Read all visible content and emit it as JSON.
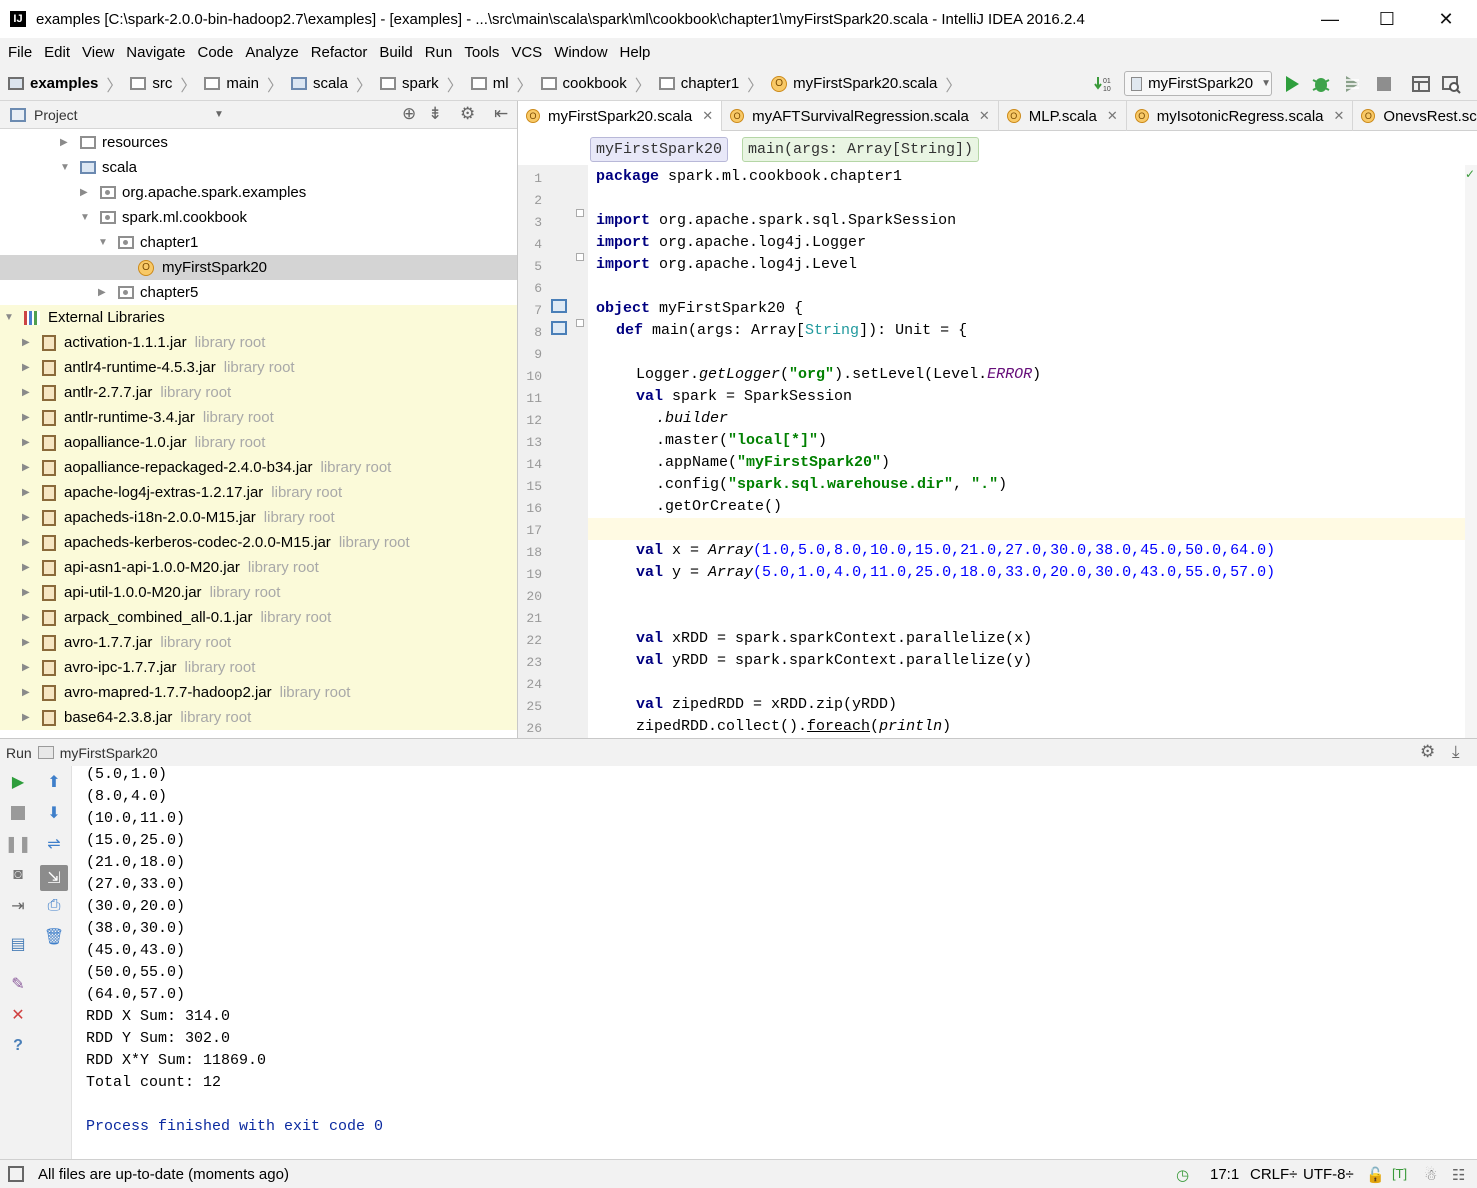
{
  "window": {
    "title": "examples [C:\\spark-2.0.0-bin-hadoop2.7\\examples] - [examples] - ...\\src\\main\\scala\\spark\\ml\\cookbook\\chapter1\\myFirstSpark20.scala - IntelliJ IDEA 2016.2.4",
    "app_icon": "IJ",
    "minimize": "—",
    "maximize": "☐",
    "close": "✕"
  },
  "menu": [
    "File",
    "Edit",
    "View",
    "Navigate",
    "Code",
    "Analyze",
    "Refactor",
    "Build",
    "Run",
    "Tools",
    "VCS",
    "Window",
    "Help"
  ],
  "breadcrumb": [
    "examples",
    "src",
    "main",
    "scala",
    "spark",
    "ml",
    "cookbook",
    "chapter1",
    "myFirstSpark20.scala"
  ],
  "toolbar": {
    "run_config": "myFirstSpark20",
    "icons": [
      "build-icon",
      "run-icon",
      "debug-icon",
      "coverage-icon",
      "stop-icon",
      "project-structure-icon",
      "search-everywhere-icon"
    ]
  },
  "project": {
    "title": "Project",
    "tree": [
      {
        "label": "resources",
        "kind": "folder",
        "indent": 1
      },
      {
        "label": "scala",
        "kind": "folder-open",
        "indent": 1
      },
      {
        "label": "org.apache.spark.examples",
        "kind": "package",
        "indent": 2
      },
      {
        "label": "spark.ml.cookbook",
        "kind": "package-open",
        "indent": 2
      },
      {
        "label": "chapter1",
        "kind": "package-open",
        "indent": 3
      },
      {
        "label": "myFirstSpark20",
        "kind": "object",
        "indent": 4
      },
      {
        "label": "chapter5",
        "kind": "package",
        "indent": 3
      },
      {
        "label": "External Libraries",
        "kind": "extlib",
        "indent": 0
      }
    ],
    "libraries": [
      "activation-1.1.1.jar",
      "antlr4-runtime-4.5.3.jar",
      "antlr-2.7.7.jar",
      "antlr-runtime-3.4.jar",
      "aopalliance-1.0.jar",
      "aopalliance-repackaged-2.4.0-b34.jar",
      "apache-log4j-extras-1.2.17.jar",
      "apacheds-i18n-2.0.0-M15.jar",
      "apacheds-kerberos-codec-2.0.0-M15.jar",
      "api-asn1-api-1.0.0-M20.jar",
      "api-util-1.0.0-M20.jar",
      "arpack_combined_all-0.1.jar",
      "avro-1.7.7.jar",
      "avro-ipc-1.7.7.jar",
      "avro-mapred-1.7.7-hadoop2.jar",
      "base64-2.3.8.jar"
    ],
    "library_suffix": "library root"
  },
  "tabs": [
    "myFirstSpark20.scala",
    "myAFTSurvivalRegression.scala",
    "MLP.scala",
    "myIsotonicRegress.scala",
    "OnevsRest.scala"
  ],
  "code_crumbs": [
    "myFirstSpark20",
    "main(args: Array[String])"
  ],
  "line_numbers": [
    "1",
    "2",
    "3",
    "4",
    "5",
    "6",
    "7",
    "8",
    "9",
    "10",
    "11",
    "12",
    "13",
    "14",
    "15",
    "16",
    "17",
    "18",
    "19",
    "20",
    "21",
    "22",
    "23",
    "24",
    "25",
    "26"
  ],
  "code": {
    "l1": "package spark.ml.cookbook.chapter1",
    "l3": "org.apache.spark.sql.SparkSession",
    "l4": "org.apache.log4j.Logger",
    "l5": "org.apache.log4j.Level",
    "import_kw": "import",
    "package_kw": "package",
    "l7_obj": "object",
    "l7_rest": " myFirstSpark20 {",
    "l8_def": "def",
    "l8_a": " main(args: Array[",
    "l8_type": "String",
    "l8_b": "]): Unit = {",
    "l10_a": "Logger.",
    "l10_m": "getLogger",
    "l10_b": "(",
    "l10_s": "\"org\"",
    "l10_c": ").setLevel(Level.",
    "l10_e": "ERROR",
    "l10_d": ")",
    "val_kw": "val",
    "l11": " spark = SparkSession",
    "l12": ".builder",
    "l13_a": ".master(",
    "l13_s": "\"local[*]\"",
    "l13_b": ")",
    "l14_a": ".appName(",
    "l14_s": "\"myFirstSpark20\"",
    "l14_b": ")",
    "l15_a": ".config(",
    "l15_s1": "\"spark.sql.warehouse.dir\"",
    "l15_c": ", ",
    "l15_s2": "\".\"",
    "l15_b": ")",
    "l16": ".getOrCreate()",
    "l18_a": " x = ",
    "array_kw": "Array",
    "l18_nums": "(1.0,5.0,8.0,10.0,15.0,21.0,27.0,30.0,38.0,45.0,50.0,64.0)",
    "l19_a": " y = ",
    "l19_nums": "(5.0,1.0,4.0,11.0,25.0,18.0,33.0,20.0,30.0,43.0,55.0,57.0)",
    "l22": " xRDD = spark.sparkContext.parallelize(x)",
    "l23": " yRDD = spark.sparkContext.parallelize(y)",
    "l25": " zipedRDD = xRDD.zip(yRDD)",
    "l26_a": "zipedRDD.collect().",
    "l26_m": "foreach",
    "l26_b": "(",
    "l26_p": "println",
    "l26_c": ")"
  },
  "run": {
    "label": "Run",
    "config": "myFirstSpark20",
    "output": [
      "(5.0,1.0)",
      "(8.0,4.0)",
      "(10.0,11.0)",
      "(15.0,25.0)",
      "(21.0,18.0)",
      "(27.0,33.0)",
      "(30.0,20.0)",
      "(38.0,30.0)",
      "(45.0,43.0)",
      "(50.0,55.0)",
      "(64.0,57.0)",
      "RDD X Sum: 314.0",
      "RDD Y Sum: 302.0",
      "RDD X*Y Sum: 11869.0",
      "Total count: 12",
      "",
      "Process finished with exit code 0"
    ]
  },
  "status": {
    "message": "All files are up-to-date (moments ago)",
    "position": "17:1",
    "line_sep": "CRLF÷",
    "encoding": "UTF-8÷",
    "vcs": "[T]"
  }
}
